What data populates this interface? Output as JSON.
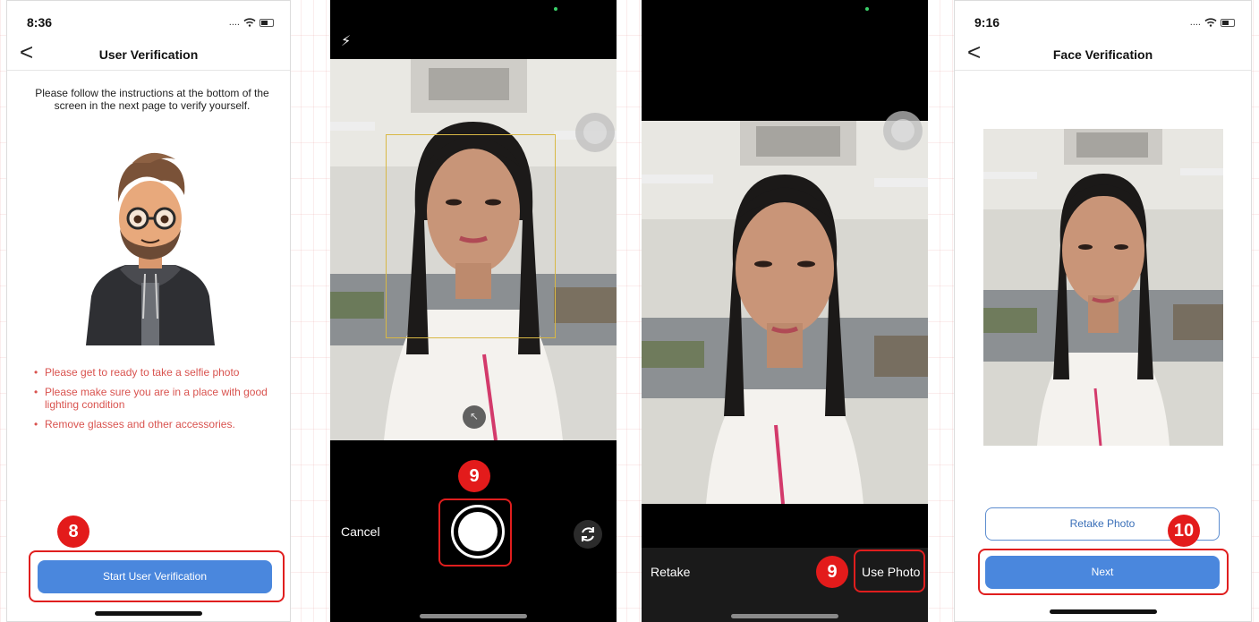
{
  "screen1": {
    "status_time": "8:36",
    "status_dots": "....",
    "back_label": "<",
    "title": "User Verification",
    "instructions": "Please follow the instructions at the bottom of the screen in the next page to verify yourself.",
    "bullets": [
      "Please get to ready to take a selfie photo",
      "Please make sure you are in a place with good lighting condition",
      "Remove glasses and other accessories."
    ],
    "start_button": "Start User Verification",
    "step_badge": "8"
  },
  "screen2": {
    "cancel_label": "Cancel",
    "step_badge": "9",
    "flash_icon": "lightning-icon",
    "flip_icon": "camera-flip-icon"
  },
  "screen3": {
    "retake_label": "Retake",
    "use_photo_label": "Use Photo",
    "step_badge": "9"
  },
  "screen4": {
    "status_time": "9:16",
    "status_dots": "....",
    "back_label": "<",
    "title": "Face Verification",
    "retake_button": "Retake Photo",
    "next_button": "Next",
    "step_badge": "10"
  },
  "colors": {
    "primary": "#4a87dd",
    "badge": "#e31b1b",
    "bullet_text": "#d9534f"
  }
}
